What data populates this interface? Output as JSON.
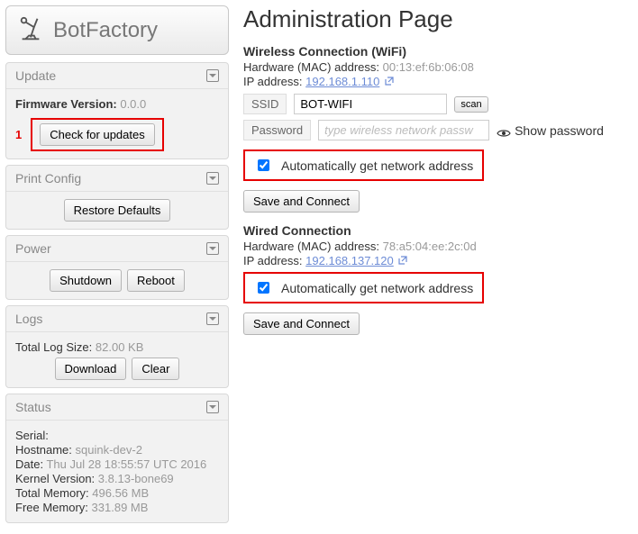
{
  "brand": {
    "title": "BotFactory"
  },
  "sidebar": {
    "update": {
      "header": "Update",
      "firmware_label": "Firmware Version:",
      "firmware_version": "0.0.0",
      "callout_num": "1",
      "check_btn": "Check for updates"
    },
    "print_config": {
      "header": "Print Config",
      "restore_btn": "Restore Defaults"
    },
    "power": {
      "header": "Power",
      "shutdown_btn": "Shutdown",
      "reboot_btn": "Reboot"
    },
    "logs": {
      "header": "Logs",
      "total_label": "Total Log Size:",
      "total_value": "82.00 KB",
      "download_btn": "Download",
      "clear_btn": "Clear"
    },
    "status": {
      "header": "Status",
      "serial_label": "Serial:",
      "serial_value": "",
      "hostname_label": "Hostname:",
      "hostname_value": "squink-dev-2",
      "date_label": "Date:",
      "date_value": "Thu Jul 28 18:55:57 UTC 2016",
      "kernel_label": "Kernel Version:",
      "kernel_value": "3.8.13-bone69",
      "totalmem_label": "Total Memory:",
      "totalmem_value": "496.56 MB",
      "freemem_label": "Free Memory:",
      "freemem_value": "331.89 MB"
    }
  },
  "main": {
    "title": "Administration Page",
    "wifi": {
      "heading": "Wireless Connection (WiFi)",
      "mac_label": "Hardware (MAC) address:",
      "mac_value": "00:13:ef:6b:06:08",
      "ip_label": "IP address:",
      "ip_value": "192.168.1.110",
      "ssid_label": "SSID",
      "ssid_value": "BOT-WIFI",
      "scan_btn": "scan",
      "pw_label": "Password",
      "pw_placeholder": "type wireless network passw",
      "show_pw": "Show password",
      "auto_label": "Automatically get network address",
      "save_btn": "Save and Connect"
    },
    "wired": {
      "heading": "Wired Connection",
      "mac_label": "Hardware (MAC) address:",
      "mac_value": "78:a5:04:ee:2c:0d",
      "ip_label": "IP address:",
      "ip_value": "192.168.137.120",
      "auto_label": "Automatically get network address",
      "save_btn": "Save and Connect"
    }
  }
}
